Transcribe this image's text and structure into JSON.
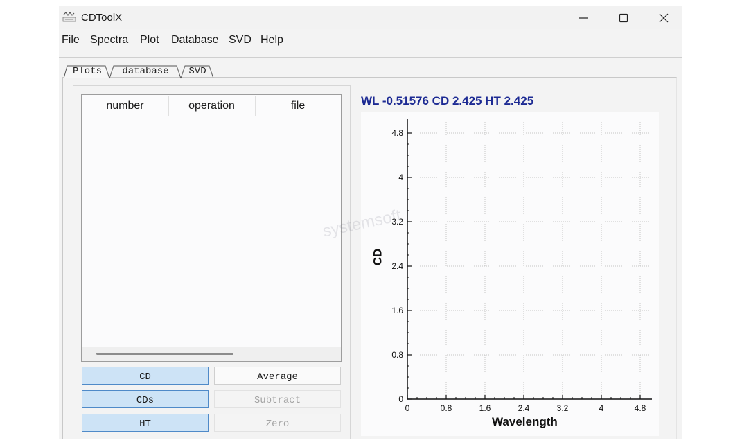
{
  "window": {
    "title": "CDToolX",
    "controls": [
      "minimize",
      "maximize",
      "close"
    ]
  },
  "menu": {
    "items": [
      "File",
      "Spectra",
      "Plot",
      "Database",
      "SVD",
      "Help"
    ]
  },
  "tabs": [
    {
      "label": "Plots",
      "active": true
    },
    {
      "label": "database",
      "active": false
    },
    {
      "label": "SVD",
      "active": false
    }
  ],
  "table": {
    "columns": [
      "number",
      "operation",
      "file"
    ],
    "rows": []
  },
  "buttons": {
    "cd": "CD",
    "average": "Average",
    "cds": "CDs",
    "subtract": "Subtract",
    "ht": "HT",
    "zero": "Zero"
  },
  "readout": {
    "text": "WL -0.51576  CD 2.425  HT 2.425"
  },
  "watermark": "systemsoft",
  "colors": {
    "readout_text": "#1c2a93",
    "checked_button": "#cde3f6",
    "checked_border": "#4f8ac8"
  },
  "chart_data": {
    "type": "line",
    "title": "",
    "xlabel": "Wavelength",
    "ylabel": "CD",
    "xlim": [
      0,
      5
    ],
    "ylim": [
      0,
      5
    ],
    "xticks": [
      "0",
      "0.8",
      "1.6",
      "2.4",
      "3.2",
      "4",
      "4.8"
    ],
    "yticks": [
      "0",
      "0.8",
      "1.6",
      "2.4",
      "3.2",
      "4",
      "4.8"
    ],
    "grid": true,
    "series": []
  }
}
